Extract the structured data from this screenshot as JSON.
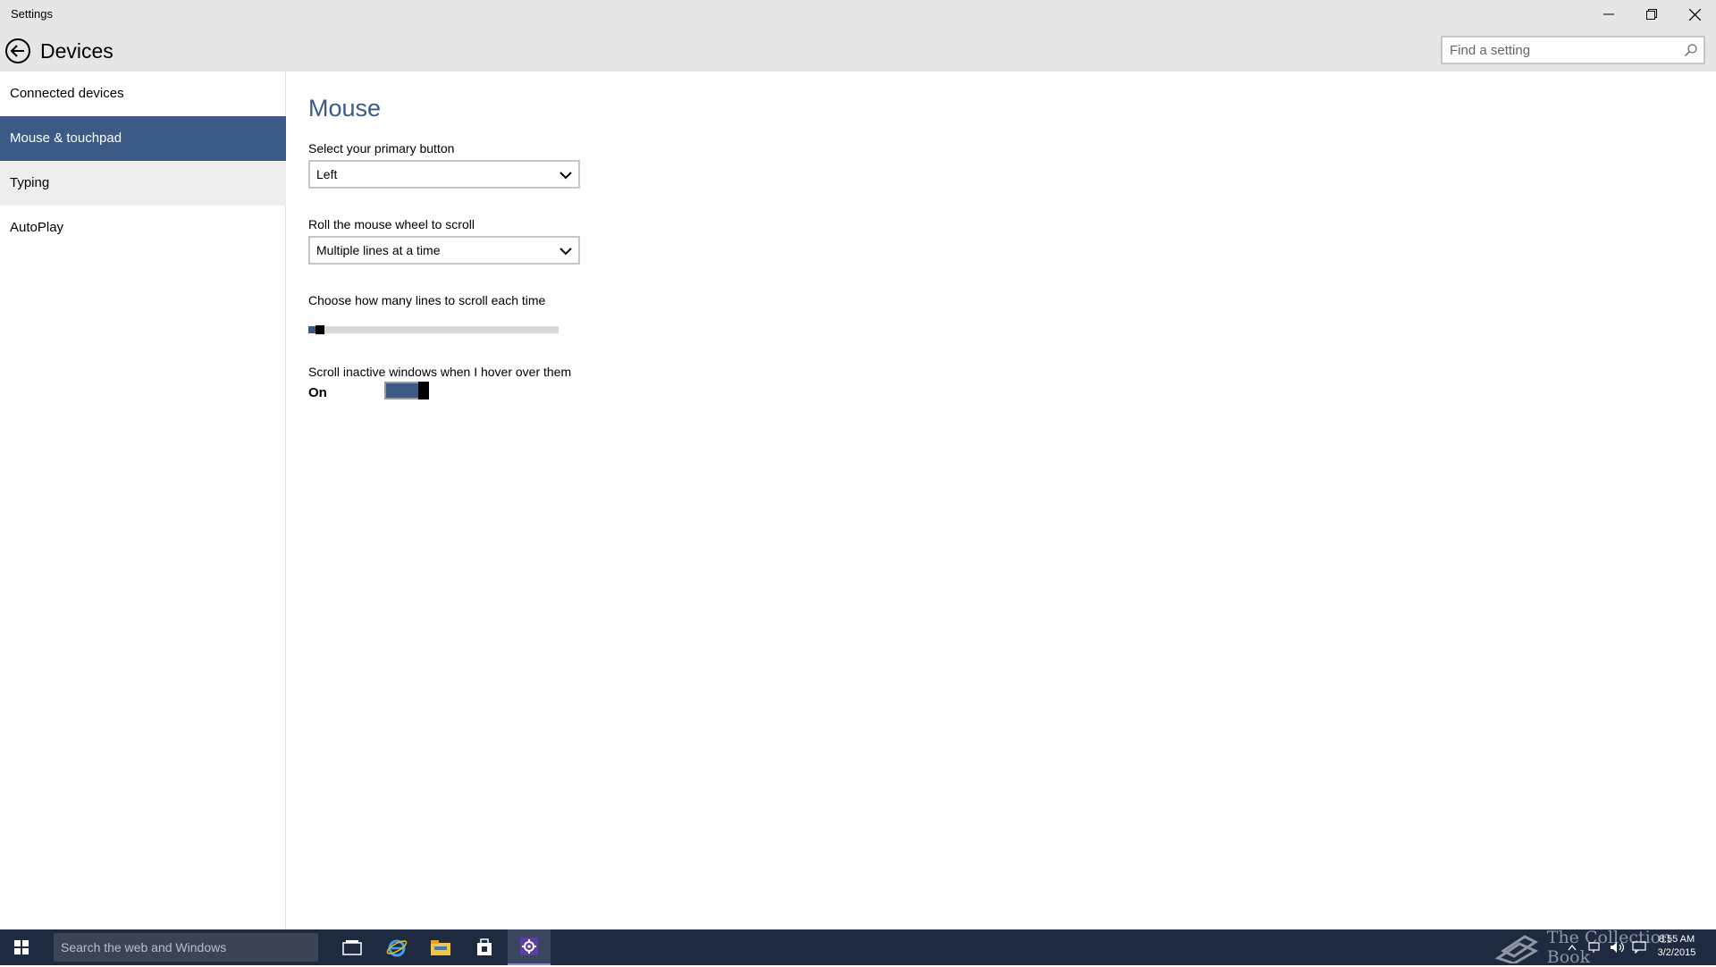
{
  "window": {
    "title": "Settings",
    "controls": [
      "minimize",
      "restore",
      "close"
    ]
  },
  "header": {
    "title": "Devices",
    "search": {
      "placeholder": "Find a setting",
      "value": ""
    }
  },
  "sidebar": {
    "items": [
      {
        "label": "Connected devices",
        "selected": false
      },
      {
        "label": "Mouse & touchpad",
        "selected": true
      },
      {
        "label": "Typing",
        "selected": false
      },
      {
        "label": "AutoPlay",
        "selected": false
      }
    ]
  },
  "main": {
    "section_title": "Mouse",
    "primary_button": {
      "label": "Select your primary button",
      "value": "Left"
    },
    "wheel_scroll": {
      "label": "Roll the mouse wheel to scroll",
      "value": "Multiple lines at a time"
    },
    "lines_slider": {
      "label": "Choose how many lines to scroll each time",
      "fraction": 0.03
    },
    "inactive_scroll": {
      "label": "Scroll inactive windows when I hover over them",
      "state": "On"
    }
  },
  "taskbar": {
    "search_placeholder": "Search the web and Windows",
    "pinned": [
      "task-view-icon",
      "internet-explorer-icon",
      "file-explorer-icon",
      "store-icon",
      "settings-icon"
    ],
    "watermark": "The Collection Book",
    "time": "8:55 AM",
    "date": "3/2/2015"
  },
  "colors": {
    "accent": "#3b5a86",
    "titlebar": "#e6e6e6",
    "taskbar": "#1e2a3f"
  }
}
